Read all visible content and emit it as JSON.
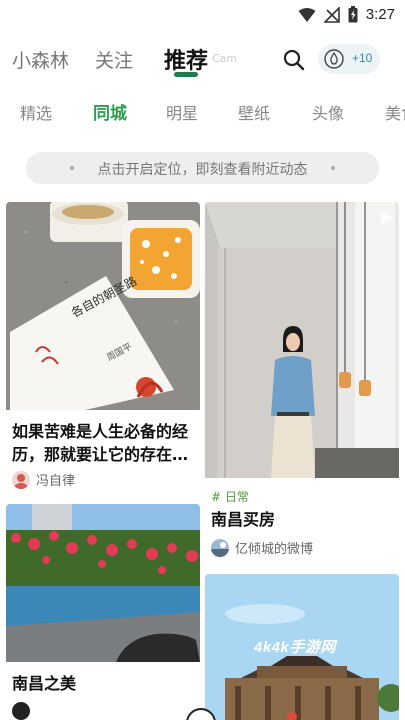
{
  "status_bar": {
    "time": "3:27"
  },
  "top_tabs": [
    "小森林",
    "关注",
    "推荐"
  ],
  "top_tab_ghost": "Cam",
  "coins": {
    "label": "+10"
  },
  "category_tabs": [
    "精选",
    "同城",
    "明星",
    "壁纸",
    "头像",
    "美食"
  ],
  "location_banner": {
    "text": "点击开启定位，即刻查看附近动态"
  },
  "cards": [
    {
      "title": "如果苦难是人生必备的经历，那就要让它的存在…",
      "author": "冯自律",
      "book_title": "各自的朝圣路",
      "book_author": "周国平"
    },
    {
      "tag": "# 日常",
      "title": "南昌买房",
      "author": "亿倾城的微博"
    },
    {
      "title": "南昌之美",
      "author": ""
    },
    {
      "title": "",
      "author": ""
    }
  ],
  "watermark": "4k4k手游网",
  "colors": {
    "accent_green": "#2e9e4f",
    "indicator_green": "#1e7d4f",
    "coin_blue": "#2a8fa0"
  }
}
